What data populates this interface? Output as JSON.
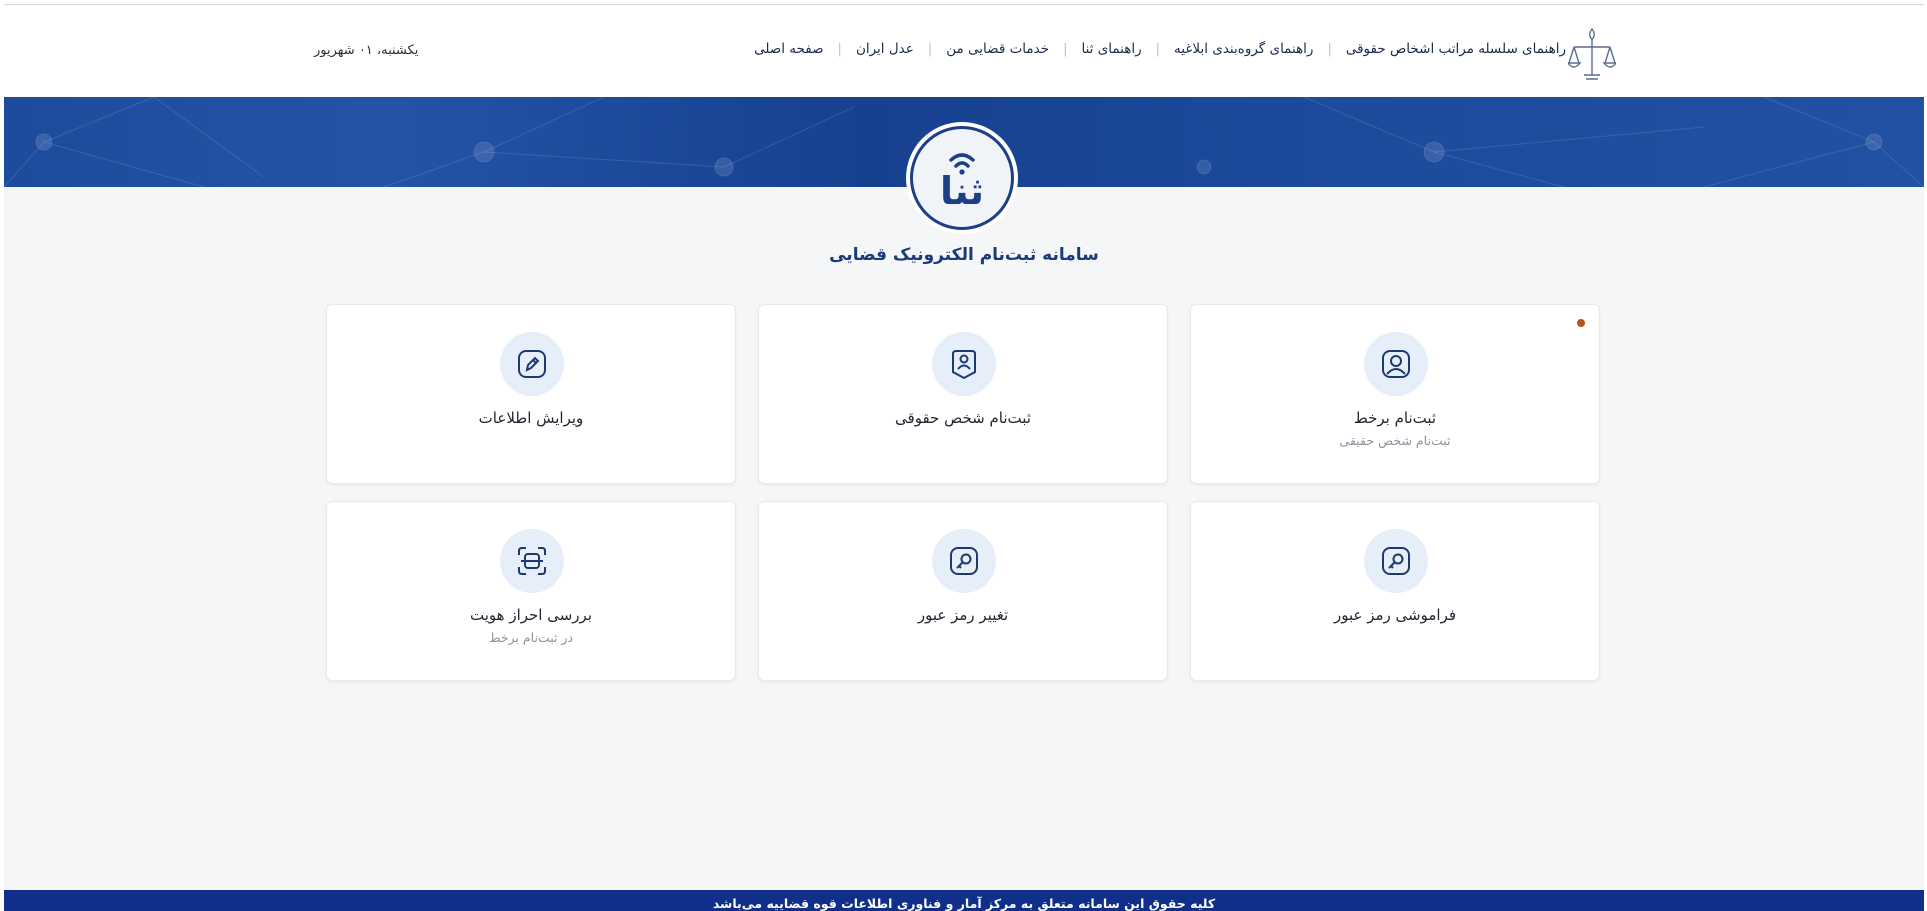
{
  "header": {
    "date": "یکشنبه، ۰۱ شهریور",
    "nav": [
      "صفحه اصلی",
      "عدل ایران",
      "خدمات قضایی من",
      "راهنمای ثنا",
      "راهنمای گروه‌بندی ابلاغیه",
      "راهنمای سلسله مراتب اشخاص حقوقی"
    ]
  },
  "main": {
    "title": "سامانه ثبت‌نام الکترونیک قضایی",
    "logo_text": "ثنا",
    "cards": [
      {
        "label": "ثبت‌نام برخط",
        "sub": "ثبت‌نام شخص حقیقی",
        "icon": "user-profile-icon"
      },
      {
        "label": "ثبت‌نام شخص حقوقی",
        "sub": "",
        "icon": "id-badge-icon"
      },
      {
        "label": "ویرایش اطلاعات",
        "sub": "",
        "icon": "edit-pencil-icon"
      },
      {
        "label": "فراموشی رمز عبور",
        "sub": "",
        "icon": "key-icon"
      },
      {
        "label": "تغییر رمز عبور",
        "sub": "",
        "icon": "key-icon"
      },
      {
        "label": "بررسی احراز هویت",
        "sub": "در ثبت‌نام برخط",
        "icon": "scan-identity-icon"
      }
    ]
  },
  "footer": {
    "text": "کلیه حقوق این سامانه متعلق به مرکز آمار و فناوری اطلاعات قوه قضاییه می‌باشد"
  },
  "colors": {
    "primary": "#1c3a7a",
    "banner": "#1e4c9c",
    "footer": "#0f2f8a",
    "icon_bg": "#e6eef9",
    "accent_dot": "#b3541e"
  }
}
